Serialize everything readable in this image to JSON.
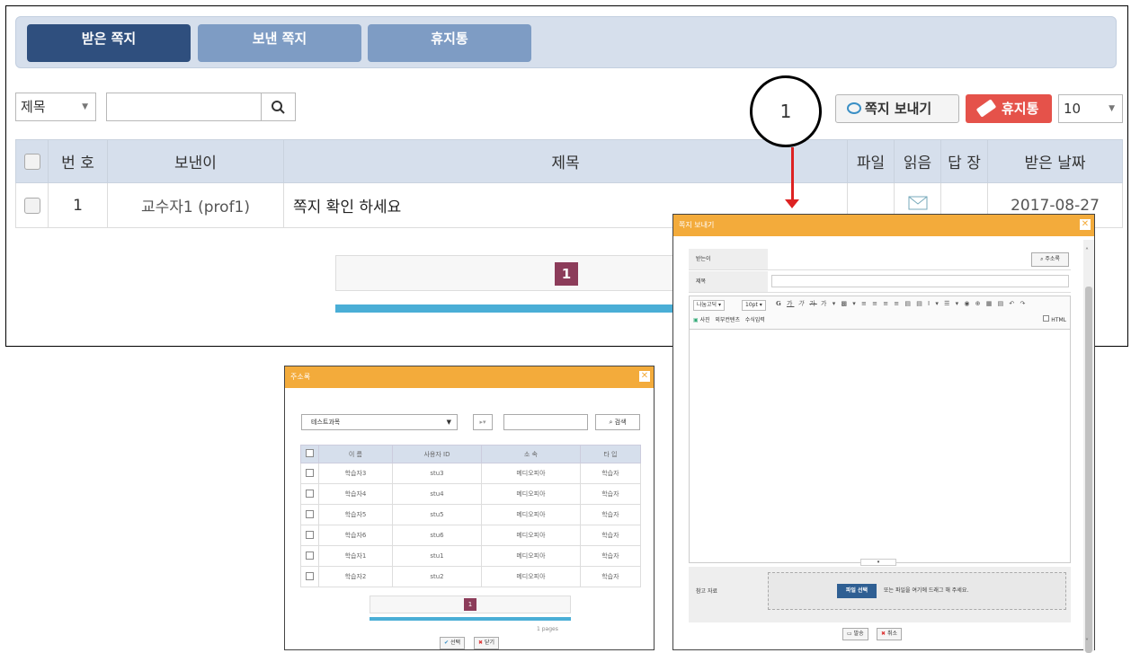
{
  "tabs": {
    "received": "받은 쪽지",
    "sent": "보낸 쪽지",
    "trash": "휴지통"
  },
  "search": {
    "field": "제목",
    "value": ""
  },
  "marker": "1",
  "buttons": {
    "send_note": "쪽지 보내기",
    "trash": "휴지통"
  },
  "page_size": "10",
  "table": {
    "headers": [
      "번 호",
      "보낸이",
      "제목",
      "파일",
      "읽음",
      "답 장",
      "받은 날짜"
    ],
    "rows": [
      {
        "num": "1",
        "sender": "교수자1 (prof1)",
        "title": "쪽지 확인 하세요",
        "file": "",
        "read": "envelope-icon",
        "reply": "",
        "date": "2017-08-27"
      }
    ]
  },
  "pager": {
    "current": "1"
  },
  "address_popup": {
    "title": "주소록",
    "course": "테스트과목",
    "search_btn": "검색",
    "headers": [
      "이 름",
      "사용자 ID",
      "소 속",
      "타 입"
    ],
    "rows": [
      [
        "학습자3",
        "stu3",
        "메디오피아",
        "학습자"
      ],
      [
        "학습자4",
        "stu4",
        "메디오피아",
        "학습자"
      ],
      [
        "학습자5",
        "stu5",
        "메디오피아",
        "학습자"
      ],
      [
        "학습자6",
        "stu6",
        "메디오피아",
        "학습자"
      ],
      [
        "학습자1",
        "stu1",
        "메디오피아",
        "학습자"
      ],
      [
        "학습자2",
        "stu2",
        "메디오피아",
        "학습자"
      ]
    ],
    "current": "1",
    "pages": "1 pages",
    "select_btn": "선택",
    "close_btn": "닫기"
  },
  "compose_popup": {
    "title": "쪽지 보내기",
    "to_label": "받는이",
    "addressbook_btn": "주소록",
    "subject_label": "제목",
    "toolbar_font": "나눔고딕",
    "toolbar_size": "10pt",
    "toolbar2": [
      "사진",
      "외부컨텐츠",
      "수식입력"
    ],
    "html": "HTML",
    "attach_label": "참고 자료",
    "file_select": "파일 선택",
    "drop_hint": "또는 파일을 여기에 드래그 해 주세요.",
    "send": "발송",
    "cancel": "취소"
  }
}
